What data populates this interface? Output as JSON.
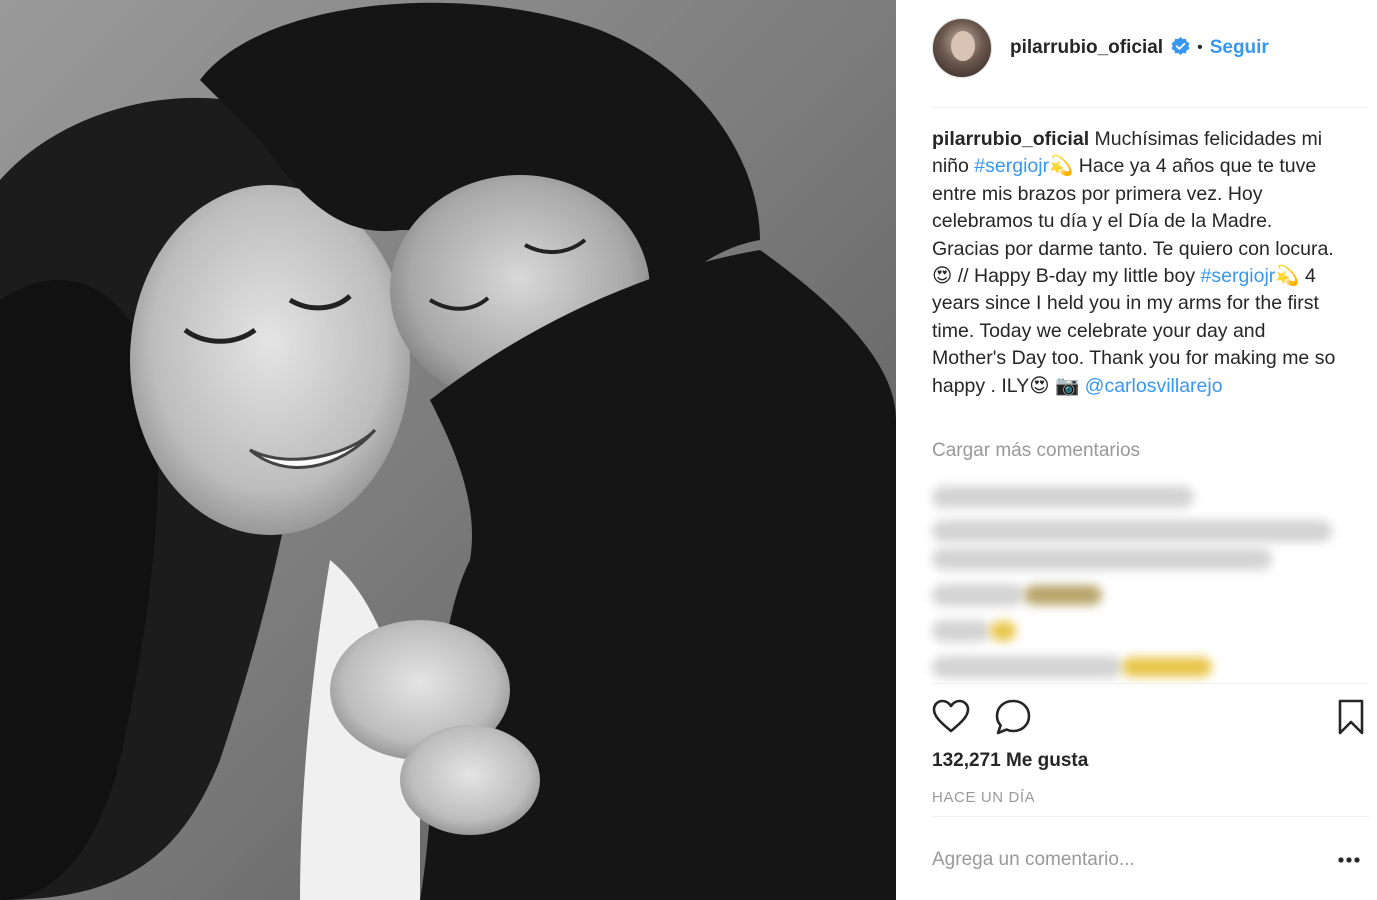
{
  "post": {
    "photo_alt": "",
    "username": "pilarrubio_oficial",
    "verified": true,
    "dot": "•",
    "follow_label": "Seguir",
    "caption": {
      "username": "pilarrubio_oficial",
      "segments": [
        {
          "type": "text",
          "value": "Muchísimas felicidades mi niño "
        },
        {
          "type": "hashtag",
          "value": "#sergiojr"
        },
        {
          "type": "text",
          "value": "💫 Hace ya 4 años que te tuve entre mis brazos por primera vez. Hoy celebramos tu día y el Día de la Madre. Gracias por darme tanto. Te quiero con locura. 😍 // Happy B-day my little boy "
        },
        {
          "type": "hashtag",
          "value": "#sergiojr"
        },
        {
          "type": "text",
          "value": "💫 4 years since I held you in my arms for the first time. Today we celebrate your day and Mother's Day too. Thank you for making me so happy . ILY😍 📷 "
        },
        {
          "type": "mention",
          "value": "@carlosvillarejo"
        }
      ]
    },
    "load_more_label": "Cargar más comentarios",
    "likes_label": "132,271 Me gusta",
    "timestamp": "HACE UN DÍA",
    "comment_placeholder": "Agrega un comentario...",
    "icons": {
      "like": "heart-outline-icon",
      "comment": "comment-bubble-icon",
      "save": "bookmark-icon",
      "verified": "verified-badge-icon",
      "more": "more-options-icon"
    },
    "colors": {
      "link": "#3897f0",
      "text": "#262626",
      "muted": "#999999",
      "divider": "#efefef"
    }
  }
}
